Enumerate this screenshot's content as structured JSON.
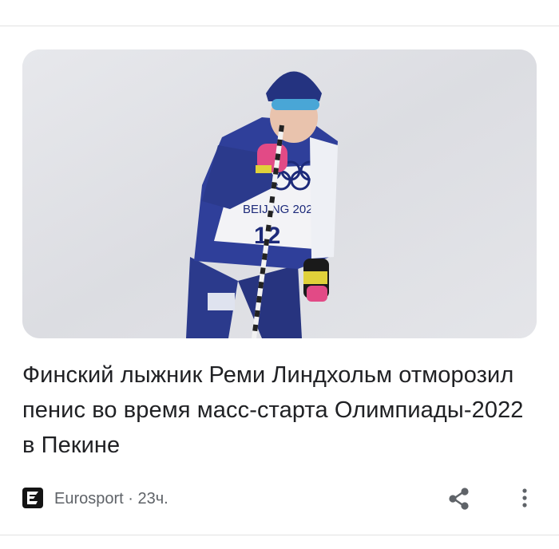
{
  "article": {
    "image_alt": "Finnish skier with bib 12 at Beijing 2022",
    "headline": "Финский лыжник Реми Линдхольм отморозил пенис во время масс-старта Олимпиады-2022 в Пекине",
    "source": "Eurosport",
    "separator": " · ",
    "time": "23ч."
  },
  "icons": {
    "source_logo": "eurosport-logo-icon",
    "share": "share-icon",
    "more": "more-vertical-icon"
  },
  "colors": {
    "headline": "#202124",
    "meta": "#5f6368",
    "icon": "#5f6368"
  }
}
